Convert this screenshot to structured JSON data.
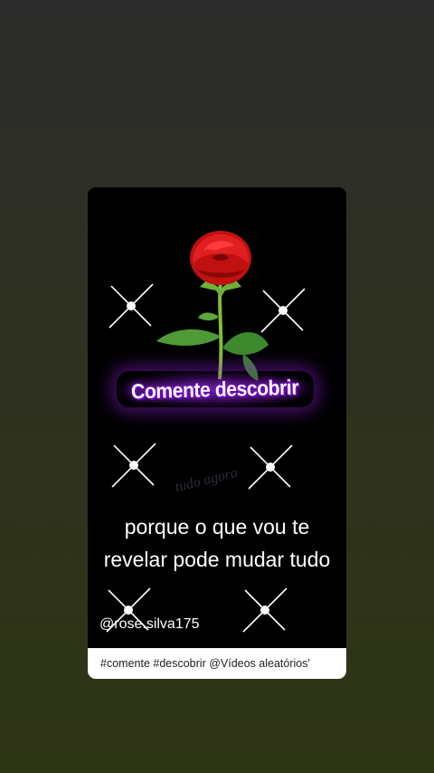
{
  "post": {
    "banner_text": "Comente descobrir",
    "watermark": "tudo agora",
    "caption_line1": "porque o que vou te",
    "caption_line2": "revelar pode mudar tudo",
    "username": "@rose.silva175",
    "hashtags": "#comente #descobrir @Vídeos aleatórios'"
  },
  "colors": {
    "banner_glow": "#a020f0",
    "card_background": "#000000",
    "tagbar_background": "#ffffff"
  },
  "icons": {
    "sparkle": "four-point-star",
    "rose": "red-rose"
  }
}
